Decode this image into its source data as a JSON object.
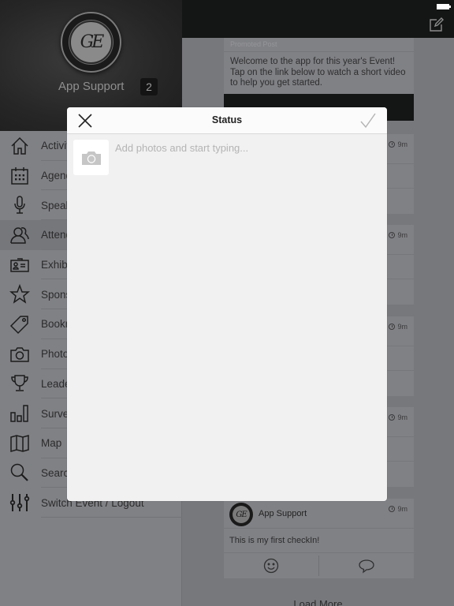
{
  "status_bar": {
    "battery_icon": "battery-full-icon"
  },
  "sidebar": {
    "profile": {
      "logo_text": "GE",
      "name": "App Support",
      "badge_count": "2"
    },
    "items": [
      {
        "label": "Activity Feed",
        "icon": "home-icon"
      },
      {
        "label": "Agenda",
        "icon": "calendar-icon"
      },
      {
        "label": "Speakers",
        "icon": "microphone-icon"
      },
      {
        "label": "Attendees",
        "icon": "people-icon",
        "selected": true
      },
      {
        "label": "Exhibitors",
        "icon": "id-card-icon"
      },
      {
        "label": "Sponsors",
        "icon": "star-icon"
      },
      {
        "label": "Bookmarks",
        "icon": "tag-icon"
      },
      {
        "label": "Photos",
        "icon": "camera-icon"
      },
      {
        "label": "Leaderboard",
        "icon": "trophy-icon"
      },
      {
        "label": "Surveys",
        "icon": "bar-chart-icon"
      },
      {
        "label": "Map",
        "icon": "map-icon"
      },
      {
        "label": "Search",
        "icon": "search-icon"
      },
      {
        "label": "Switch Event / Logout",
        "icon": "sliders-icon"
      }
    ]
  },
  "topbar": {
    "compose_icon": "compose-icon"
  },
  "feed": {
    "promoted": {
      "label": "Promoted Post",
      "body": "Welcome to the app for this year's Event! Tap on the link below to watch a short video to help you get started."
    },
    "posts": [
      {
        "time": "9m",
        "author": "",
        "text": ""
      },
      {
        "time": "9m",
        "author": "",
        "text": ""
      },
      {
        "time": "9m",
        "author": "",
        "text": ""
      },
      {
        "time": "9m",
        "author": "",
        "text": ""
      },
      {
        "time": "9m",
        "author": "App Support",
        "avatar_text": "GE",
        "text": "This is my first checkIn!"
      }
    ],
    "load_more": "Load More"
  },
  "modal": {
    "title": "Status",
    "close_icon": "close-icon",
    "done_icon": "checkmark-icon",
    "photo_icon": "camera-icon",
    "input": {
      "value": "",
      "placeholder": "Add photos and start typing..."
    }
  }
}
